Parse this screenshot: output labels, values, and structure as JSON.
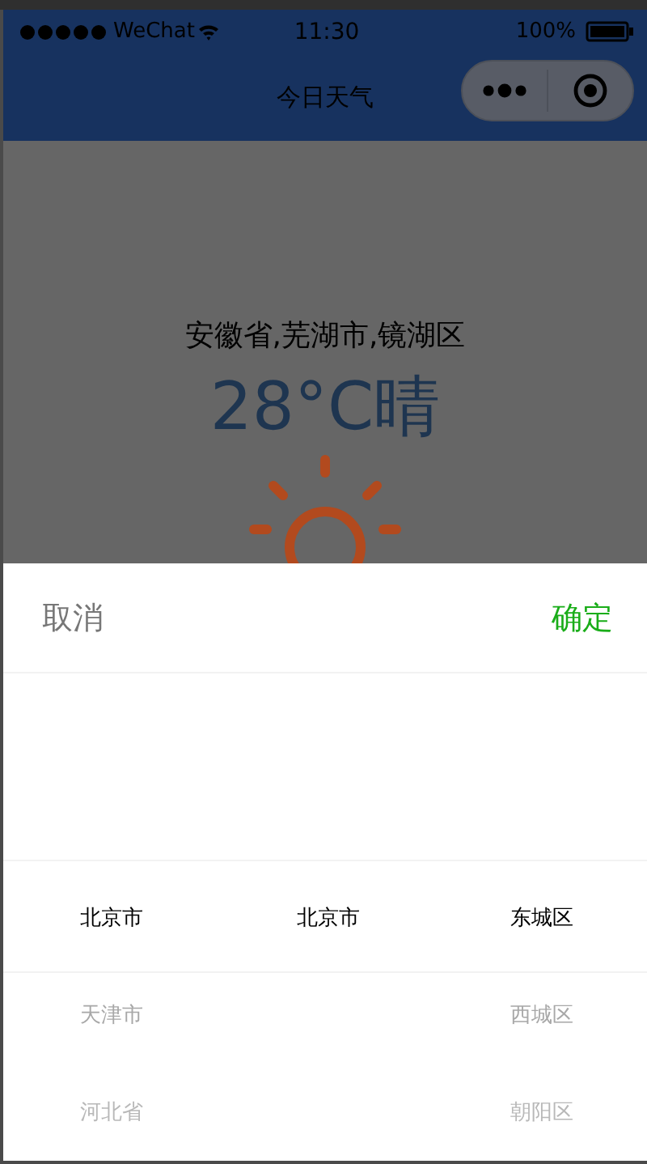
{
  "status_bar": {
    "carrier": "WeChat",
    "time": "11:30",
    "battery": "100%"
  },
  "nav_bar": {
    "title": "今日天气"
  },
  "weather": {
    "location": "安徽省,芜湖市,镜湖区",
    "temperature": "28°C晴"
  },
  "picker": {
    "cancel": "取消",
    "confirm": "确定",
    "columns": [
      {
        "items": [
          {
            "label": "北京市",
            "selected": true
          },
          {
            "label": "天津市",
            "selected": false
          },
          {
            "label": "河北省",
            "selected": false
          }
        ]
      },
      {
        "items": [
          {
            "label": "北京市",
            "selected": true
          }
        ]
      },
      {
        "items": [
          {
            "label": "东城区",
            "selected": true
          },
          {
            "label": "西城区",
            "selected": false
          },
          {
            "label": "朝阳区",
            "selected": false
          }
        ]
      }
    ]
  }
}
